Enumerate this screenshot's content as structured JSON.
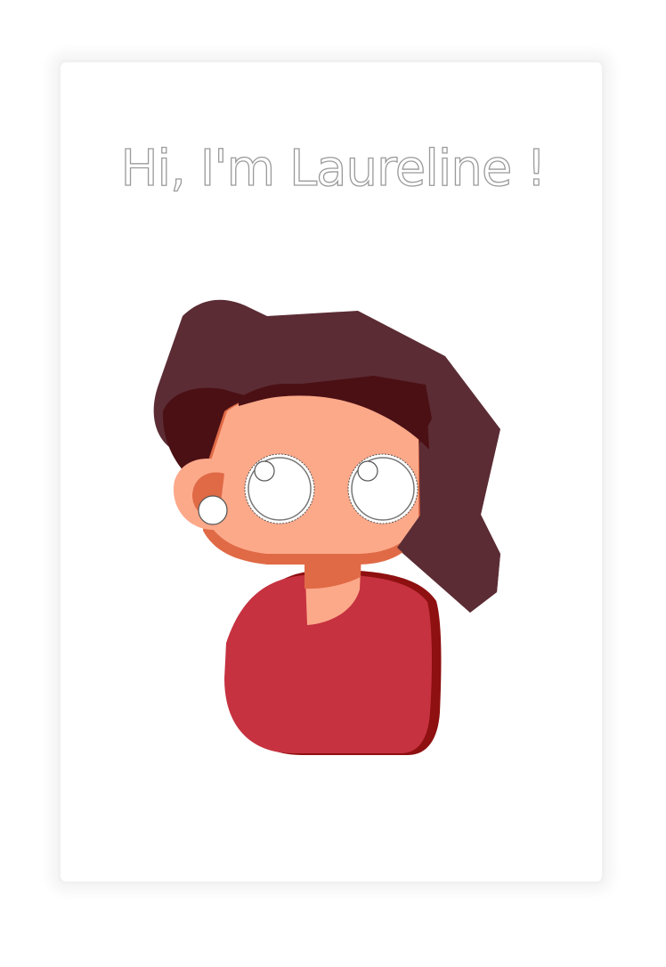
{
  "greeting": "Hi, I'm Laureline !",
  "colors": {
    "hair": "#5b2c34",
    "hair_dark": "#4b1014",
    "skin": "#fca98a",
    "skin_shadow": "#e06a46",
    "shirt": "#c63240",
    "shirt_shadow": "#8e1010",
    "eye_white": "#ffffff",
    "eye_outline": "#555555"
  }
}
